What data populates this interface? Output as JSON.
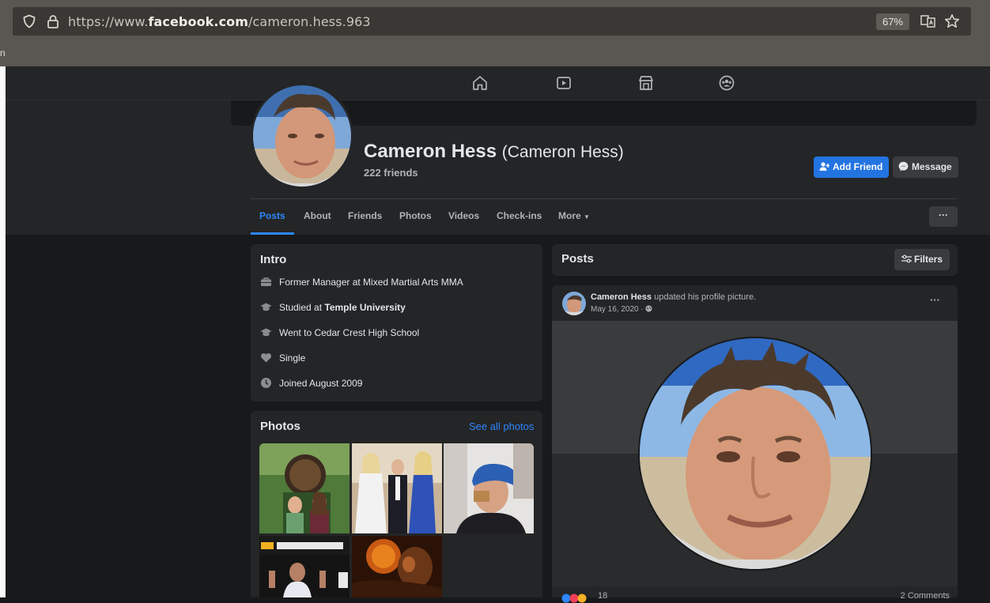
{
  "browser": {
    "url_prefix": "https://www.",
    "url_domain": "facebook.com",
    "url_path": "/cameron.hess.963",
    "zoom": "67%",
    "edge_char": "n"
  },
  "nav": {
    "icons": [
      "home-icon",
      "watch-icon",
      "marketplace-icon",
      "groups-icon"
    ]
  },
  "profile": {
    "name": "Cameron Hess",
    "alt_name": "(Cameron Hess)",
    "friends": "222 friends",
    "add_friend": "Add Friend",
    "message": "Message"
  },
  "tabs": {
    "items": [
      "Posts",
      "About",
      "Friends",
      "Photos",
      "Videos",
      "Check-ins",
      "More"
    ],
    "more_menu": "···"
  },
  "intro": {
    "title": "Intro",
    "items": [
      {
        "icon": "briefcase-icon",
        "text": "Former Manager at Mixed Martial Arts MMA"
      },
      {
        "icon": "graduation-cap-icon",
        "text_prefix": "Studied at ",
        "text_bold": "Temple University"
      },
      {
        "icon": "graduation-cap-icon",
        "text": "Went to Cedar Crest High School"
      },
      {
        "icon": "heart-icon",
        "text": "Single"
      },
      {
        "icon": "clock-icon",
        "text": "Joined August 2009"
      }
    ]
  },
  "photos": {
    "title": "Photos",
    "see_all": "See all photos"
  },
  "posts": {
    "title": "Posts",
    "filters": "Filters",
    "post": {
      "author": "Cameron Hess",
      "action": "updated his profile picture.",
      "date": "May 16, 2020 · ",
      "menu": "···",
      "reactions": "18",
      "comments": "2 Comments"
    }
  },
  "colors": {
    "accent": "#2374e1",
    "link": "#2d88ff",
    "card": "#242526",
    "background": "#18191a"
  }
}
